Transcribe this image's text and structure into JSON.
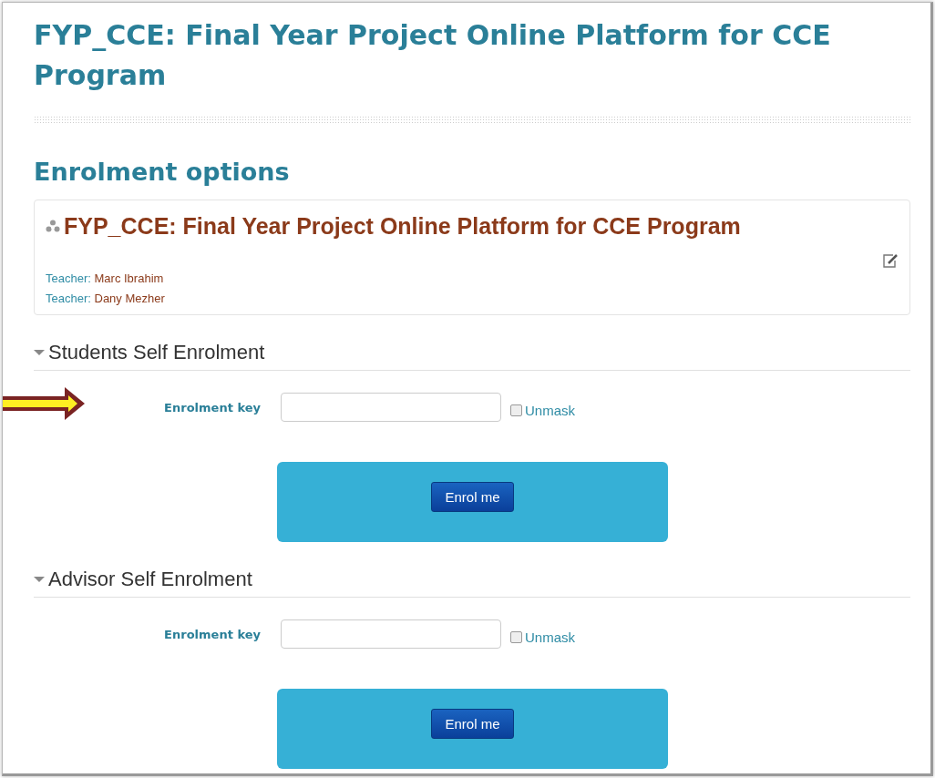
{
  "page_title": "FYP_CCE: Final Year Project Online Platform for CCE Program",
  "heading": "Enrolment options",
  "course": {
    "title": "FYP_CCE: Final Year Project Online Platform for CCE Program",
    "teachers": [
      {
        "role": "Teacher:",
        "name": "Marc Ibrahim"
      },
      {
        "role": "Teacher:",
        "name": "Dany Mezher"
      }
    ]
  },
  "sections": [
    {
      "title": "Students Self Enrolment",
      "expanded": true,
      "key_label": "Enrolment key",
      "unmask_label": "Unmask",
      "unmask_checked": false,
      "button": "Enrol me"
    },
    {
      "title": "Advisor Self Enrolment",
      "expanded": true,
      "key_label": "Enrolment key",
      "unmask_label": "Unmask",
      "unmask_checked": false,
      "button": "Enrol me"
    }
  ]
}
